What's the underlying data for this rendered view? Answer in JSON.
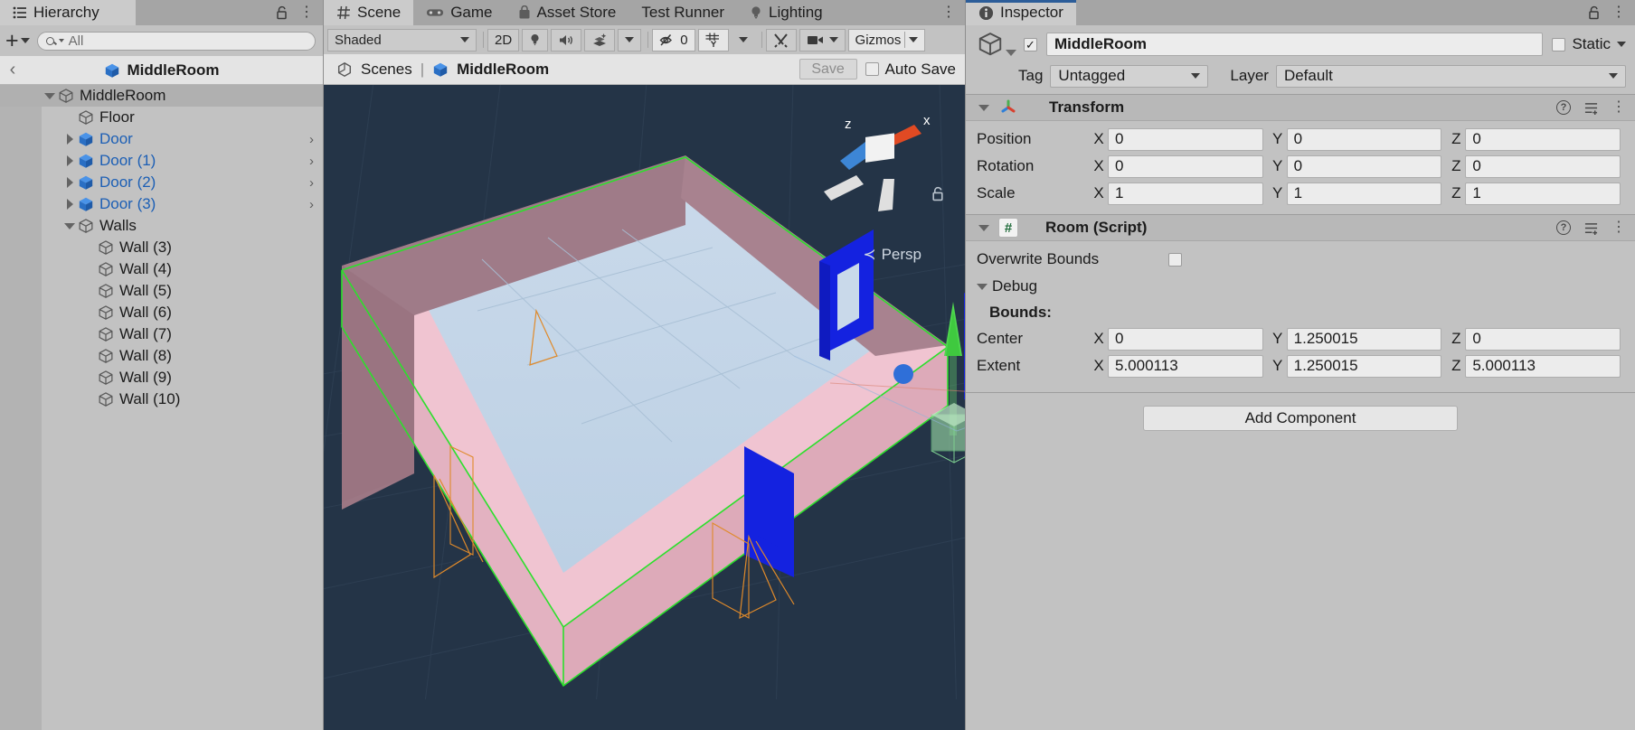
{
  "hierarchy": {
    "tab_label": "Hierarchy",
    "lock_icon": "lock-open-icon",
    "menu_icon": "kebab-menu-icon",
    "add_label": "+",
    "search": {
      "placeholder": "All",
      "value": "",
      "icon": "search-icon"
    },
    "breadcrumb": {
      "back_icon": "chevron-left-icon",
      "title": "MiddleRoom"
    },
    "items": [
      {
        "label": "MiddleRoom",
        "depth": 0,
        "twisty": "down",
        "icon": "cube-grey-icon",
        "selected": true,
        "prefab": false,
        "chevron": false
      },
      {
        "label": "Floor",
        "depth": 1,
        "twisty": "none",
        "icon": "cube-grey-icon",
        "selected": false,
        "prefab": false,
        "chevron": false
      },
      {
        "label": "Door",
        "depth": 1,
        "twisty": "right",
        "icon": "cube-blue-icon",
        "selected": false,
        "prefab": true,
        "chevron": true
      },
      {
        "label": "Door (1)",
        "depth": 1,
        "twisty": "right",
        "icon": "cube-blue-icon",
        "selected": false,
        "prefab": true,
        "chevron": true
      },
      {
        "label": "Door (2)",
        "depth": 1,
        "twisty": "right",
        "icon": "cube-blue-icon",
        "selected": false,
        "prefab": true,
        "chevron": true
      },
      {
        "label": "Door (3)",
        "depth": 1,
        "twisty": "right",
        "icon": "cube-blue-icon",
        "selected": false,
        "prefab": true,
        "chevron": true
      },
      {
        "label": "Walls",
        "depth": 1,
        "twisty": "down",
        "icon": "cube-grey-icon",
        "selected": false,
        "prefab": false,
        "chevron": false
      },
      {
        "label": "Wall (3)",
        "depth": 2,
        "twisty": "none",
        "icon": "cube-grey-icon",
        "selected": false,
        "prefab": false,
        "chevron": false
      },
      {
        "label": "Wall (4)",
        "depth": 2,
        "twisty": "none",
        "icon": "cube-grey-icon",
        "selected": false,
        "prefab": false,
        "chevron": false
      },
      {
        "label": "Wall (5)",
        "depth": 2,
        "twisty": "none",
        "icon": "cube-grey-icon",
        "selected": false,
        "prefab": false,
        "chevron": false
      },
      {
        "label": "Wall (6)",
        "depth": 2,
        "twisty": "none",
        "icon": "cube-grey-icon",
        "selected": false,
        "prefab": false,
        "chevron": false
      },
      {
        "label": "Wall (7)",
        "depth": 2,
        "twisty": "none",
        "icon": "cube-grey-icon",
        "selected": false,
        "prefab": false,
        "chevron": false
      },
      {
        "label": "Wall (8)",
        "depth": 2,
        "twisty": "none",
        "icon": "cube-grey-icon",
        "selected": false,
        "prefab": false,
        "chevron": false
      },
      {
        "label": "Wall (9)",
        "depth": 2,
        "twisty": "none",
        "icon": "cube-grey-icon",
        "selected": false,
        "prefab": false,
        "chevron": false
      },
      {
        "label": "Wall (10)",
        "depth": 2,
        "twisty": "none",
        "icon": "cube-grey-icon",
        "selected": false,
        "prefab": false,
        "chevron": false
      }
    ]
  },
  "scene": {
    "tabs": [
      {
        "label": "Scene",
        "icon": "hash-icon",
        "active": true
      },
      {
        "label": "Game",
        "icon": "gamepad-icon",
        "active": false
      },
      {
        "label": "Asset Store",
        "icon": "shopping-bag-icon",
        "active": false
      },
      {
        "label": "Test Runner",
        "icon": "none",
        "active": false
      },
      {
        "label": "Lighting",
        "icon": "lightbulb-icon",
        "active": false
      }
    ],
    "menu_icon": "kebab-menu-icon",
    "toolbar": {
      "draw_mode": "Shaded",
      "mode_2d": "2D",
      "lighting_icon": "lightbulb-icon",
      "audio_icon": "speaker-icon",
      "fx_icon": "effects-icon",
      "hidden_count": "0",
      "hidden_icon": "eye-off-icon",
      "grid_icon": "grid-y-icon",
      "tools_icon": "tools-icon",
      "camera_icon": "camera-icon",
      "gizmos_label": "Gizmos"
    },
    "breadcrumb": {
      "scenes_label": "Scenes",
      "scenes_icon": "unity-icon",
      "separator": "|",
      "object_label": "MiddleRoom",
      "object_icon": "cube-blue-icon"
    },
    "save_label": "Save",
    "autosave_label": "Auto Save",
    "autosave_checked": false,
    "viewport": {
      "gizmo_axes": {
        "z": "z",
        "x": "x"
      },
      "persp_label": "Persp",
      "persp_arrow": "≺",
      "lock_icon": "lock-open-icon",
      "background_color": "#243447",
      "floor_color": "#c3d5e8",
      "wall_color": "#9a7682",
      "trim_color": "#f2c5d2",
      "door_color": "#1422e0",
      "outline_color": "#22dd22"
    }
  },
  "inspector": {
    "tab_label": "Inspector",
    "tab_icon": "info-icon",
    "lock_icon": "lock-open-icon",
    "menu_icon": "kebab-menu-icon",
    "object": {
      "icon": "cube-grey-icon",
      "enabled": true,
      "name": "MiddleRoom",
      "static_label": "Static",
      "static_checked": false,
      "tag_label": "Tag",
      "tag_value": "Untagged",
      "layer_label": "Layer",
      "layer_value": "Default"
    },
    "transform": {
      "title": "Transform",
      "icon": "transform-axis-icon",
      "expanded": true,
      "help_icon": "help-icon",
      "preset_icon": "preset-icon",
      "menu_icon": "kebab-menu-icon",
      "rows": [
        {
          "label": "Position",
          "x": "0",
          "y": "0",
          "z": "0"
        },
        {
          "label": "Rotation",
          "x": "0",
          "y": "0",
          "z": "0"
        },
        {
          "label": "Scale",
          "x": "1",
          "y": "1",
          "z": "1"
        }
      ],
      "axis_labels": [
        "X",
        "Y",
        "Z"
      ]
    },
    "room_script": {
      "title": "Room (Script)",
      "icon": "script-icon",
      "icon_glyph": "#",
      "expanded": true,
      "help_icon": "help-icon",
      "preset_icon": "preset-icon",
      "menu_icon": "kebab-menu-icon",
      "overwrite_bounds_label": "Overwrite Bounds",
      "overwrite_bounds_checked": false,
      "debug_label": "Debug",
      "debug_expanded": true,
      "bounds_label": "Bounds:",
      "bounds_rows": [
        {
          "label": "Center",
          "x": "0",
          "y": "1.250015",
          "z": "0"
        },
        {
          "label": "Extent",
          "x": "5.000113",
          "y": "1.250015",
          "z": "5.000113"
        }
      ],
      "axis_labels": [
        "X",
        "Y",
        "Z"
      ]
    },
    "add_component_label": "Add Component"
  }
}
